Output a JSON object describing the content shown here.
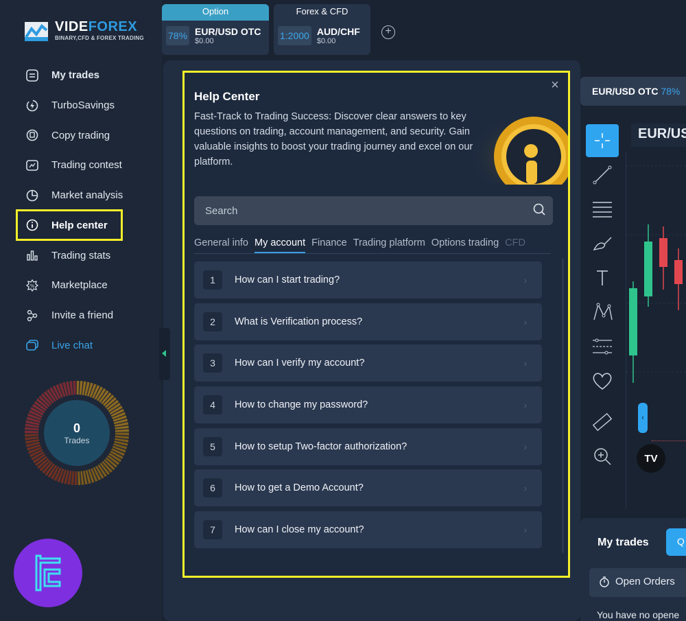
{
  "logo": {
    "brand_a": "VIDE",
    "brand_b": "FOREX",
    "tagline": "BINARY,CFD & FOREX TRADING"
  },
  "top_tabs": [
    {
      "header": "Option",
      "header_color": "#3a9fc4",
      "badge": "78%",
      "symbol": "EUR/USD OTC",
      "amount": "$0.00"
    },
    {
      "header": "Forex & CFD",
      "header_color": "#26344a",
      "badge": "1:2000",
      "symbol": "AUD/CHF",
      "amount": "$0.00"
    }
  ],
  "sidebar": {
    "items": [
      {
        "label": "My trades",
        "icon": "trades-icon"
      },
      {
        "label": "TurboSavings",
        "icon": "turbo-icon"
      },
      {
        "label": "Copy trading",
        "icon": "copy-icon"
      },
      {
        "label": "Trading contest",
        "icon": "contest-icon"
      },
      {
        "label": "Market analysis",
        "icon": "analysis-icon"
      },
      {
        "label": "Help center",
        "icon": "info-icon"
      },
      {
        "label": "Trading stats",
        "icon": "stats-icon"
      },
      {
        "label": "Marketplace",
        "icon": "marketplace-icon"
      },
      {
        "label": "Invite a friend",
        "icon": "invite-icon"
      },
      {
        "label": "Live chat",
        "icon": "chat-icon"
      }
    ],
    "donut": {
      "count": "0",
      "label": "Trades"
    }
  },
  "help": {
    "title": "Help Center",
    "description": "Fast-Track to Trading Success: Discover clear answers to key questions on trading, account management, and security. Gain valuable insights to boost your trading journey and excel on our platform.",
    "search_placeholder": "Search",
    "tabs": [
      "General info",
      "My account",
      "Finance",
      "Trading platform",
      "Options trading",
      "CFD"
    ],
    "selected_tab": "My account",
    "faqs": [
      {
        "n": "1",
        "q": "How can I start trading?"
      },
      {
        "n": "2",
        "q": "What is Verification process?"
      },
      {
        "n": "3",
        "q": "How can I verify my account?"
      },
      {
        "n": "4",
        "q": "How to change my password?"
      },
      {
        "n": "5",
        "q": "How to setup Two-factor authorization?"
      },
      {
        "n": "6",
        "q": "How to get a Demo Account?"
      },
      {
        "n": "7",
        "q": "How can I close my account?"
      }
    ]
  },
  "chart": {
    "pair_label": "EUR/USD OTC",
    "pair_pct": "78%",
    "title": "EUR/US",
    "tv_logo": "TV"
  },
  "trades": {
    "title": "My trades",
    "button": "Q",
    "open_orders": "Open Orders",
    "empty": "You have no opene"
  },
  "colors": {
    "accent": "#2fa5f0",
    "highlight": "#f5ee2a",
    "green": "#2fc48d",
    "red": "#e2474f"
  }
}
